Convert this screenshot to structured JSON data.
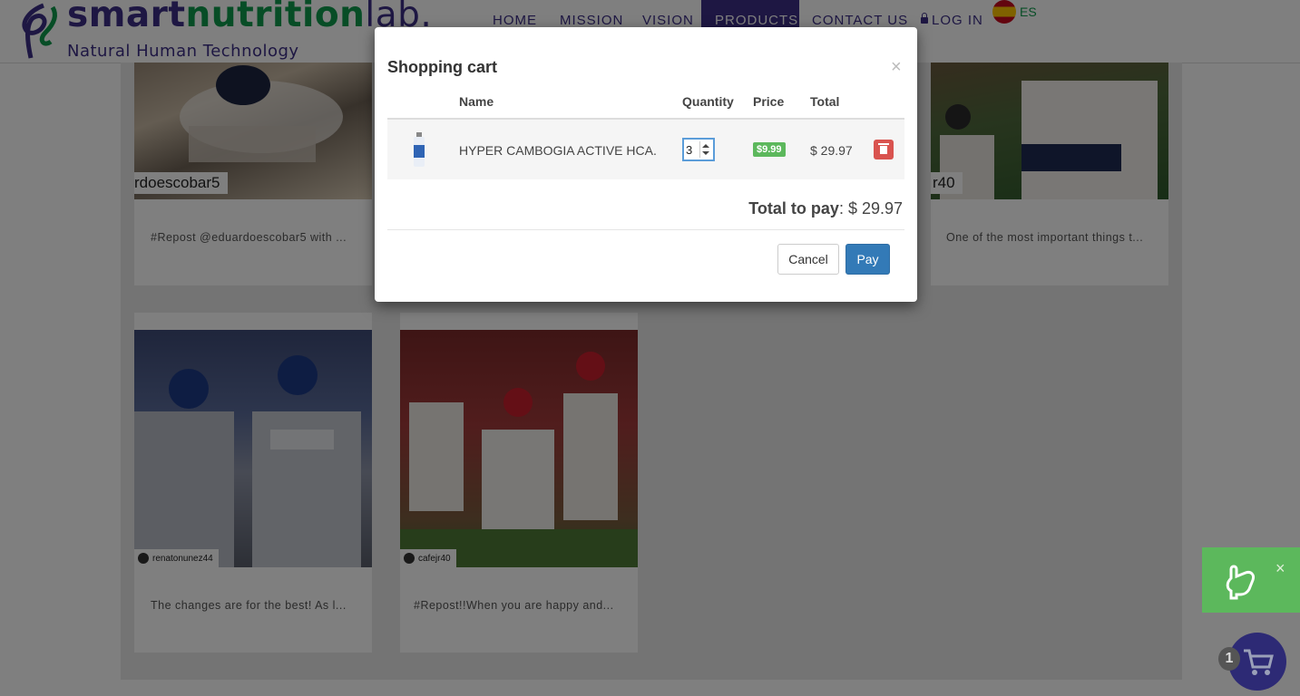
{
  "brand": {
    "logo_part1": "smart",
    "logo_part2": "nutrition",
    "logo_part3": "lab.",
    "tagline": "Natural Human Technology",
    "primary_color": "#3c2e86",
    "green_color": "#0f9b4c"
  },
  "nav": {
    "home": "HOME",
    "mission": "MISSION",
    "vision": "VISION",
    "products": "PRODUCTS",
    "contact": "CONTACT US",
    "login": "LOG IN",
    "language": "ES",
    "active_item": "PRODUCTS"
  },
  "posts": [
    {
      "handle": "rdoescobar5",
      "caption": "#Repost @eduardoescobar5 with ..."
    },
    {
      "handle": "r40",
      "caption": "One of the most important things t..."
    },
    {
      "handle": "renatonunez44",
      "caption": "The changes are for the best! As l..."
    },
    {
      "handle": "cafejr40",
      "caption": "#Repost!!When you are happy and..."
    }
  ],
  "modal": {
    "title": "Shopping cart",
    "close_symbol": "×",
    "columns": [
      "Name",
      "Quantity",
      "Price",
      "Total"
    ],
    "items": [
      {
        "name": "HYPER CAMBOGIA ACTIVE HCA.",
        "quantity": "3",
        "price": "$9.99",
        "total": "$ 29.97"
      }
    ],
    "total_label": "Total to pay",
    "total_value": ": $ 29.97",
    "cancel_label": "Cancel",
    "pay_label": "Pay"
  },
  "widgets": {
    "promo_close": "×",
    "cart_count": "1"
  },
  "icons": [
    "logo-icon",
    "lock-icon",
    "spain-flag-icon",
    "close-icon",
    "bottle-icon",
    "trash-icon",
    "hand-pointer-icon",
    "cart-icon"
  ]
}
